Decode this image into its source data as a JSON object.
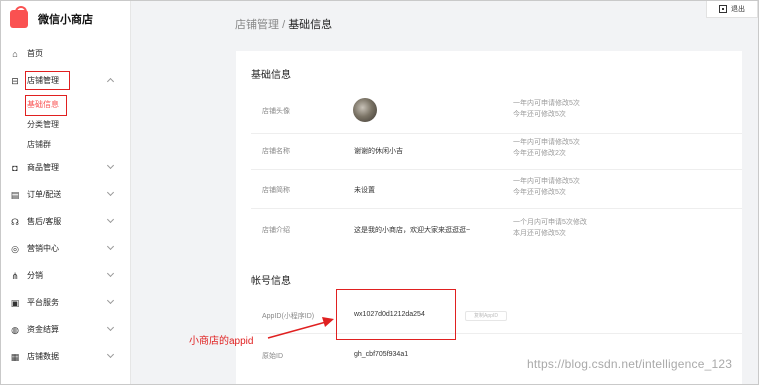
{
  "app": {
    "name": "微信小商店",
    "brand_color": "#fa5151"
  },
  "sidebar": {
    "home": {
      "label": "首页",
      "icon": "home-icon"
    },
    "shop_mgmt": {
      "label": "店铺管理",
      "icon": "shop-icon"
    },
    "shop_sub": [
      {
        "label": "基础信息"
      },
      {
        "label": "分类管理"
      },
      {
        "label": "店铺群"
      }
    ],
    "items": [
      {
        "label": "商品管理",
        "icon": "bag-icon"
      },
      {
        "label": "订单/配送",
        "icon": "order-icon"
      },
      {
        "label": "售后/客服",
        "icon": "headset-icon"
      },
      {
        "label": "营销中心",
        "icon": "target-icon"
      },
      {
        "label": "分销",
        "icon": "share-icon"
      },
      {
        "label": "平台服务",
        "icon": "service-icon"
      },
      {
        "label": "资金结算",
        "icon": "money-icon"
      },
      {
        "label": "店铺数据",
        "icon": "chart-icon"
      }
    ]
  },
  "header": {
    "breadcrumb_parent": "店铺管理",
    "breadcrumb_sep": "/",
    "breadcrumb_current": "基础信息",
    "exit_label": "退出"
  },
  "basic": {
    "title": "基础信息",
    "avatar": {
      "label": "店铺头像",
      "note1": "一年内可申请修改5次",
      "note2": "今年还可修改5次"
    },
    "name": {
      "label": "店铺名称",
      "value": "谢谢的休闲小吉",
      "note1": "一年内可申请修改5次",
      "note2": "今年还可修改2次"
    },
    "short": {
      "label": "店铺简称",
      "value": "未设置",
      "note1": "一年内可申请修改5次",
      "note2": "今年还可修改5次"
    },
    "intro": {
      "label": "店铺介绍",
      "value": "这是我的小商店，欢迎大家来逛逛逛~",
      "note1": "一个月内可申请5次修改",
      "note2": "本月还可修改5次"
    }
  },
  "account": {
    "title": "帐号信息",
    "appid": {
      "label": "AppID(小程序ID)",
      "value": "wx1027d0d1212da254",
      "copy_label": "复制AppID"
    },
    "original": {
      "label": "原始ID",
      "value": "gh_cbf705f934a1"
    }
  },
  "annotation": {
    "text": "小商店的appid",
    "color": "#e02020"
  },
  "watermark": "https://blog.csdn.net/intelligence_123"
}
